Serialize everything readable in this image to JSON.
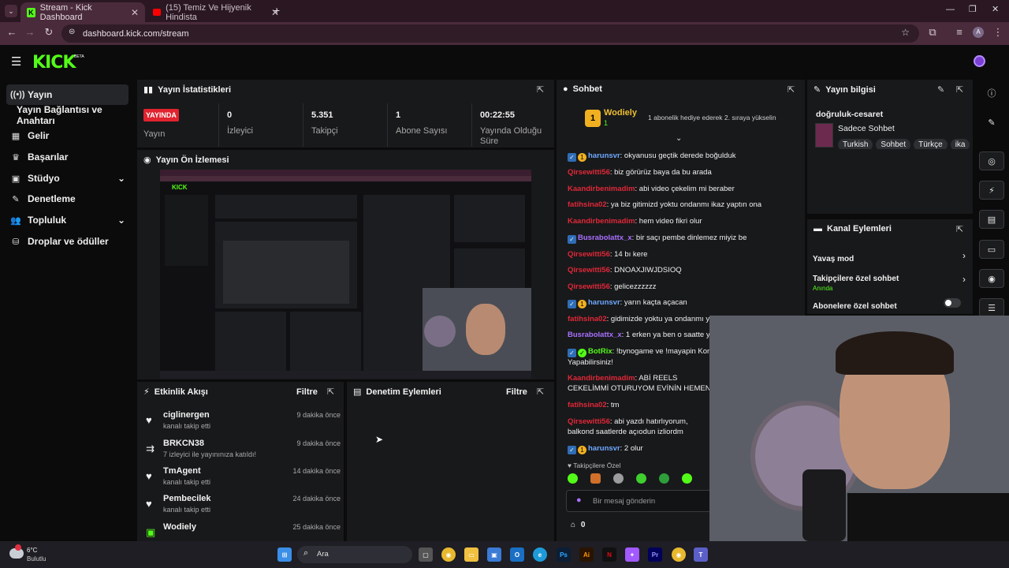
{
  "browser": {
    "tabs": [
      {
        "title": "Stream - Kick Dashboard"
      },
      {
        "title": "(15) Temiz Ve Hijyenik Hindista"
      }
    ],
    "url": "dashboard.kick.com/stream",
    "new_tab": "+",
    "profile_initial": "A"
  },
  "kick": {
    "logo": "KICK",
    "beta": "BETA"
  },
  "sidebar": {
    "items": [
      {
        "label": "Yayın",
        "icon": "broadcast-icon"
      },
      {
        "label": "Yayın Bağlantısı ve Anahtarı",
        "icon": "key-icon"
      },
      {
        "label": "Gelir",
        "icon": "revenue-icon"
      },
      {
        "label": "Başarılar",
        "icon": "trophy-icon"
      },
      {
        "label": "Stüdyo",
        "icon": "studio-icon"
      },
      {
        "label": "Denetleme",
        "icon": "moderation-icon"
      },
      {
        "label": "Topluluk",
        "icon": "community-icon"
      },
      {
        "label": "Droplar ve ödüller",
        "icon": "drops-icon"
      }
    ]
  },
  "stats": {
    "title": "Yayın İstatistikleri",
    "live_badge": "YAYINDA",
    "items": [
      {
        "value": "",
        "label": "Yayın"
      },
      {
        "value": "0",
        "label": "İzleyici"
      },
      {
        "value": "5.351",
        "label": "Takipçi"
      },
      {
        "value": "1",
        "label": "Abone Sayısı"
      },
      {
        "value": "00:22:55",
        "label": "Yayında Olduğu Süre"
      }
    ]
  },
  "preview": {
    "title": "Yayın Ön İzlemesi"
  },
  "activity": {
    "title": "Etkinlik Akışı",
    "filter": "Filtre",
    "items": [
      {
        "name": "ciglinergen",
        "sub": "kanalı takip etti",
        "time": "9 dakika önce",
        "icon": "heart-icon"
      },
      {
        "name": "BRKCN38",
        "sub": "7 izleyici ile yayınınıza katıldı!",
        "time": "9 dakika önce",
        "icon": "raid-icon"
      },
      {
        "name": "TmAgent",
        "sub": "kanalı takip etti",
        "time": "14 dakika önce",
        "icon": "heart-icon"
      },
      {
        "name": "Pembecilek",
        "sub": "kanalı takip etti",
        "time": "24 dakika önce",
        "icon": "heart-icon"
      },
      {
        "name": "Wodiely",
        "sub": "",
        "time": "25 dakika önce",
        "icon": "gift-icon"
      }
    ]
  },
  "modactions": {
    "title": "Denetim Eylemleri",
    "filter": "Filtre"
  },
  "chat": {
    "title": "Sohbet",
    "pinned_user": "Wodiely",
    "pinned_sub": "1",
    "pinned_msg": "1 abonelik hediye ederek 2. sıraya yükselin",
    "messages": [
      {
        "user": "harunsvr",
        "text": ": okyanusu geçtik derede boğulduk",
        "color": "#6ea8ff"
      },
      {
        "user": "Qirsewitti56",
        "text": ": biz görürüz baya da bu arada",
        "color": "#e02838"
      },
      {
        "user": "Kaandirbenimadim",
        "text": ": abi video çekelim mi beraber",
        "color": "#e02838"
      },
      {
        "user": "fatihsina02",
        "text": ": ya biz gitimizd yoktu ondanmı ikaz yaptın ona",
        "color": "#e02838"
      },
      {
        "user": "Kaandirbenimadim",
        "text": ": hem video fikri olur",
        "color": "#e02838"
      },
      {
        "user": "Busrabolattx_x",
        "text": ": bir saçı pembe dinlemez miyiz be",
        "color": "#a970ff"
      },
      {
        "user": "Qirsewitti56",
        "text": ": 14 bı kere",
        "color": "#e02838"
      },
      {
        "user": "Qirsewitti56",
        "text": ": DNOAXJIWJDSIOQ",
        "color": "#e02838"
      },
      {
        "user": "Qirsewitti56",
        "text": ": gelicezzzzzz",
        "color": "#e02838"
      },
      {
        "user": "harunsvr",
        "text": ": yarın kaçta açacan",
        "color": "#6ea8ff"
      },
      {
        "user": "fatihsina02",
        "text": ": gidimizde yoktu ya ondanmı ya",
        "color": "#e02838"
      },
      {
        "user": "Busrabolattx_x",
        "text": ": 1 erken ya ben o saatte y",
        "color": "#a970ff"
      },
      {
        "user": "BotRix",
        "text": ": !bynogame ve !mayapin Kom Yapabilirsiniz!",
        "color": "#53fc18"
      },
      {
        "user": "Kaandirbenimadim",
        "text": ": ABİ REELS CEKELİMMİ OTURUYOM EVİNİN HEMEN",
        "color": "#e02838"
      },
      {
        "user": "fatihsina02",
        "text": ": tm",
        "color": "#e02838"
      },
      {
        "user": "Qirsewitti56",
        "text": ": abi yazdı hatırlıyorum, balkond saatlerde açıodun izliordm",
        "color": "#e02838"
      },
      {
        "user": "harunsvr",
        "text": ": 2 olur",
        "color": "#6ea8ff"
      }
    ],
    "followers_only": "Takipçilere Özel",
    "input_placeholder": "Bir mesaj gönderin",
    "points": "0"
  },
  "info": {
    "title": "Yayın bilgisi",
    "stream_title": "doğruluk-cesaret",
    "category": "Sadece Sohbet",
    "tags": [
      "Turkish",
      "Sohbet",
      "Türkçe",
      "ika"
    ]
  },
  "channel_actions": {
    "title": "Kanal Eylemleri",
    "items": [
      {
        "label": "Yavaş mod",
        "sub": ""
      },
      {
        "label": "Takipçilere özel sohbet",
        "sub": "Anında"
      },
      {
        "label": "Abonelere özel sohbet",
        "sub": ""
      }
    ]
  },
  "taskbar": {
    "weather_temp": "6°C",
    "weather_desc": "Bulutlu",
    "search": "Ara"
  },
  "colors": {
    "kick_green": "#53fc18",
    "live_red": "#e0232e",
    "accent_purple": "#a970ff"
  }
}
